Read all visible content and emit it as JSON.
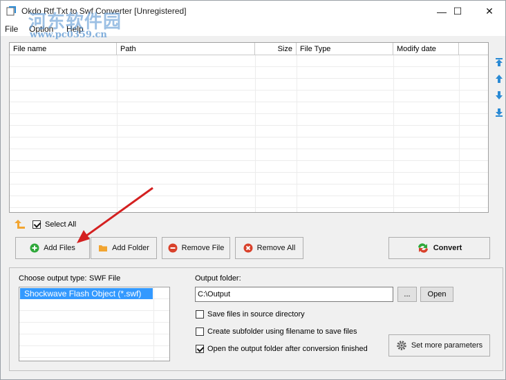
{
  "window": {
    "title": "Okdo Rtf Txt to Swf Converter [Unregistered]",
    "minimize": "—",
    "maximize": "☐",
    "close": "✕"
  },
  "watermark": {
    "text": "河东软件园",
    "url": "www.pc0359.cn"
  },
  "menu": {
    "file": "File",
    "option": "Option",
    "help": "Help"
  },
  "grid": {
    "columns": [
      "File name",
      "Path",
      "Size",
      "File Type",
      "Modify date"
    ]
  },
  "select_all": {
    "label": "Select All",
    "checked": true
  },
  "buttons": {
    "add_files": "Add Files",
    "add_folder": "Add Folder",
    "remove_file": "Remove File",
    "remove_all": "Remove All",
    "convert": "Convert"
  },
  "output": {
    "type_label": "Choose output type:",
    "type_value": "SWF File",
    "type_options": [
      "Shockwave Flash Object (*.swf)"
    ],
    "folder_label": "Output folder:",
    "folder_value": "C:\\Output",
    "browse_label": "...",
    "open_label": "Open",
    "save_in_source": {
      "label": "Save files in source directory",
      "checked": false
    },
    "create_subfolder": {
      "label": "Create subfolder using filename to save files",
      "checked": false
    },
    "open_after": {
      "label": "Open the output folder after conversion finished",
      "checked": true
    },
    "more_params": "Set more parameters"
  },
  "colors": {
    "accent": "#3399ff",
    "move_arrows": "#2a8ad4",
    "add_green": "#2fa83a",
    "remove_red": "#d9412b",
    "folder_orange": "#f2a531",
    "pointer_red": "#d42020"
  }
}
